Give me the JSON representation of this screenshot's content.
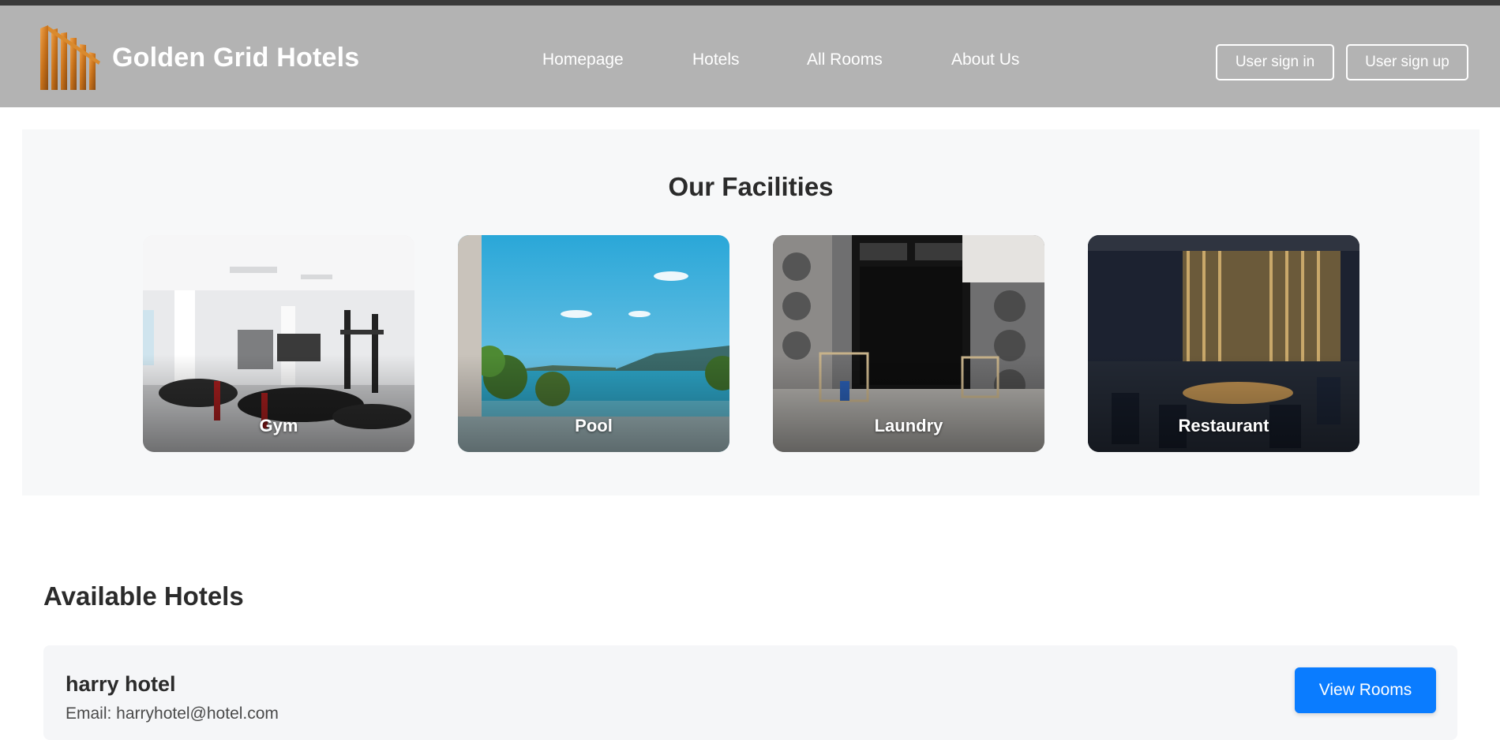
{
  "header": {
    "brand": "Golden Grid Hotels",
    "logo_icon": "building-grid-logo",
    "nav": [
      {
        "label": "Homepage"
      },
      {
        "label": "Hotels"
      },
      {
        "label": "All Rooms"
      },
      {
        "label": "About Us"
      }
    ],
    "sign_in_label": "User sign in",
    "sign_up_label": "User sign up"
  },
  "facilities": {
    "title": "Our Facilities",
    "items": [
      {
        "label": "Gym",
        "image": "gym-photo"
      },
      {
        "label": "Pool",
        "image": "pool-photo"
      },
      {
        "label": "Laundry",
        "image": "laundry-photo"
      },
      {
        "label": "Restaurant",
        "image": "restaurant-photo"
      }
    ]
  },
  "hotels": {
    "title": "Available Hotels",
    "list": [
      {
        "name": "harry hotel",
        "email": "Email: harryhotel@hotel.com",
        "button_label": "View Rooms"
      }
    ]
  },
  "colors": {
    "navbar": "#b3b3b3",
    "brand_gold": "#c7791f",
    "primary_button": "#0a7cff",
    "section_bg": "#f7f8f9"
  }
}
